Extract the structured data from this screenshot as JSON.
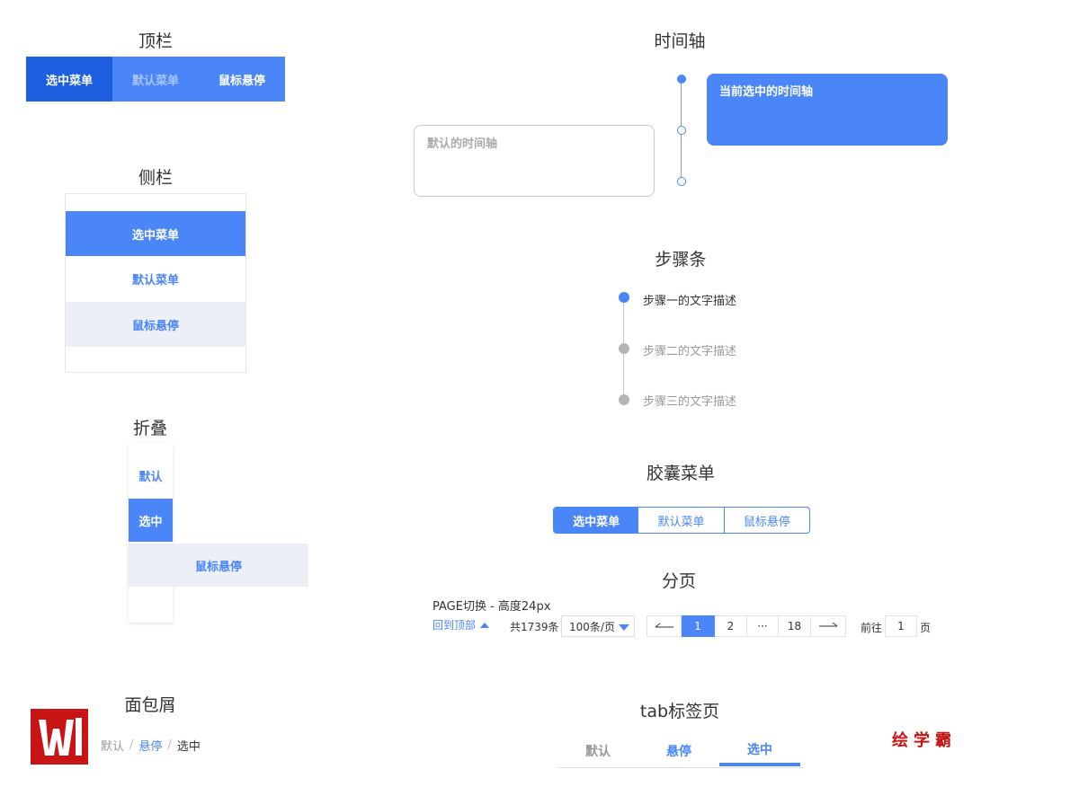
{
  "topbar": {
    "title": "顶栏",
    "items": [
      "选中菜单",
      "默认菜单",
      "鼠标悬停"
    ]
  },
  "sidebar": {
    "title": "侧栏",
    "items": [
      "选中菜单",
      "默认菜单",
      "鼠标悬停"
    ]
  },
  "collapse": {
    "title": "折叠",
    "items": [
      "默认",
      "选中",
      "鼠标悬停"
    ]
  },
  "breadcrumb": {
    "title": "面包屑",
    "items": [
      "默认",
      "悬停",
      "选中"
    ],
    "separator": "/"
  },
  "timeline": {
    "title": "时间轴",
    "selected_text": "当前选中的时间轴",
    "default_text": "默认的时间轴"
  },
  "steps": {
    "title": "步骤条",
    "items": [
      "步骤一的文字描述",
      "步骤二的文字描述",
      "步骤三的文字描述"
    ]
  },
  "capsule": {
    "title": "胶囊菜单",
    "items": [
      "选中菜单",
      "默认菜单",
      "鼠标悬停"
    ]
  },
  "pagination": {
    "title": "分页",
    "label": "PAGE切换 - 高度24px",
    "back_to_top": "回到顶部",
    "total": "共1739条",
    "page_size": "100条/页",
    "pages": [
      "1",
      "2",
      "···",
      "18"
    ],
    "current_page": "1",
    "goto_prefix": "前往",
    "goto_value": "1",
    "goto_suffix": "页"
  },
  "tabs": {
    "title": "tab标签页",
    "items": [
      "默认",
      "悬停",
      "选中"
    ]
  },
  "brand": "绘学霸",
  "colors": {
    "primary": "#4a86f7",
    "primary_dark": "#1e5fe0",
    "hover_bg": "#eceff6",
    "brand_red": "#c81414"
  }
}
